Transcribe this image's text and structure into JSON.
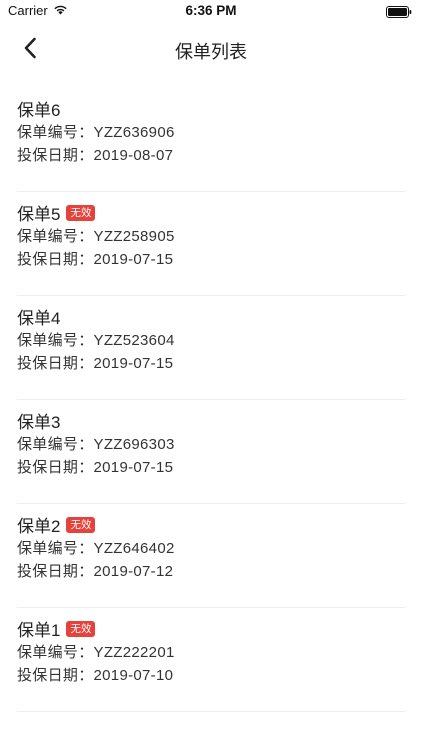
{
  "status_bar": {
    "carrier": "Carrier",
    "time": "6:36 PM",
    "icons": [
      "wifi-icon",
      "battery-icon"
    ]
  },
  "nav": {
    "title": "保单列表",
    "back_icon": "chevron-left-icon"
  },
  "colors": {
    "badge_bg": "#e5423c",
    "divider": "#eeeeee"
  },
  "policies": [
    {
      "title": "保单6",
      "badge": "",
      "number_label": "保单编号：",
      "number": "YZZ636906",
      "date_label": "投保日期：",
      "date": "2019-08-07"
    },
    {
      "title": "保单5",
      "badge": "无效",
      "number_label": "保单编号：",
      "number": "YZZ258905",
      "date_label": "投保日期：",
      "date": "2019-07-15"
    },
    {
      "title": "保单4",
      "badge": "",
      "number_label": "保单编号：",
      "number": "YZZ523604",
      "date_label": "投保日期：",
      "date": "2019-07-15"
    },
    {
      "title": "保单3",
      "badge": "",
      "number_label": "保单编号：",
      "number": "YZZ696303",
      "date_label": "投保日期：",
      "date": "2019-07-15"
    },
    {
      "title": "保单2",
      "badge": "无效",
      "number_label": "保单编号：",
      "number": "YZZ646402",
      "date_label": "投保日期：",
      "date": "2019-07-12"
    },
    {
      "title": "保单1",
      "badge": "无效",
      "number_label": "保单编号：",
      "number": "YZZ222201",
      "date_label": "投保日期：",
      "date": "2019-07-10"
    }
  ]
}
